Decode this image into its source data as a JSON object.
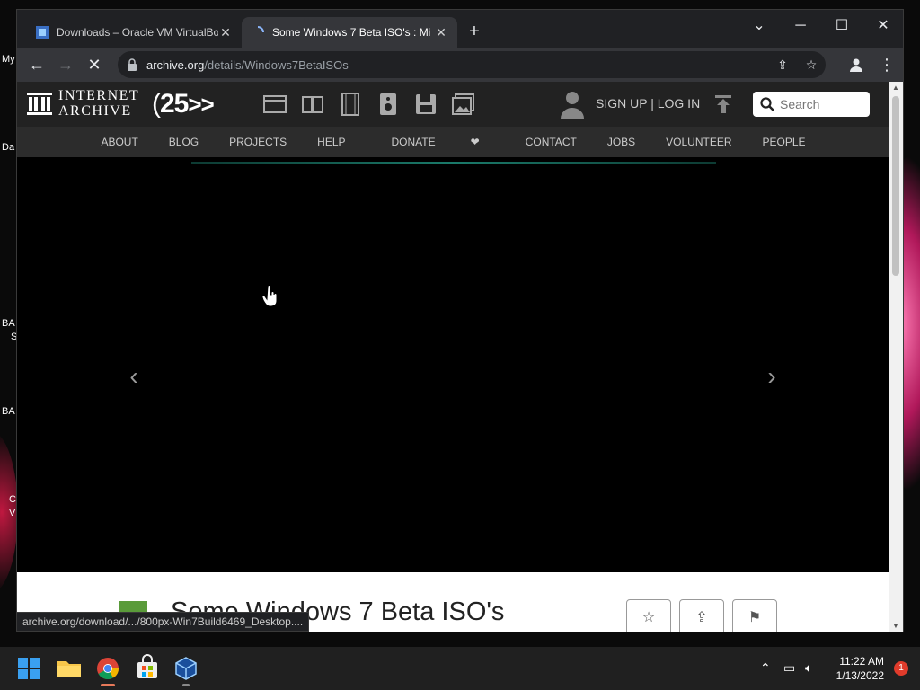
{
  "desktop": {
    "labels": [
      "My",
      "Da",
      "BA",
      "S",
      "BA",
      "C",
      "V"
    ]
  },
  "browser": {
    "tabs": [
      {
        "title": "Downloads – Oracle VM VirtualBox",
        "active": false
      },
      {
        "title": "Some Windows 7 Beta ISO's : Mi",
        "active": true
      }
    ],
    "new_tab": "+",
    "window_controls": {
      "dropdown": "⌄",
      "minimize": "─",
      "maximize": "☐",
      "close": "✕"
    },
    "url": {
      "domain": "archive.org",
      "path": "/details/Windows7BetaISOs"
    },
    "status_bar": "archive.org/download/.../800px-Win7Build6469_Desktop...."
  },
  "site": {
    "wordmark_line1": "INTERNET",
    "wordmark_line2": "ARCHIVE",
    "anniversary": "25",
    "auth": "SIGN UP | LOG IN",
    "search_placeholder": "Search",
    "nav": [
      "ABOUT",
      "BLOG",
      "PROJECTS",
      "HELP",
      "DONATE",
      "CONTACT",
      "JOBS",
      "VOLUNTEER",
      "PEOPLE"
    ],
    "carousel": {
      "dots": 9,
      "active_dot": 1,
      "prev": "‹",
      "next": "›"
    },
    "item_title": "Some Windows 7 Beta ISO's"
  },
  "taskbar": {
    "time": "11:22 AM",
    "date": "1/13/2022",
    "notifications": "1"
  },
  "colors": {
    "accent_heart": "#e02020",
    "carousel_line": "#1a7a6a",
    "chrome_bg": "#202124",
    "taskbar_bg": "#202020"
  }
}
